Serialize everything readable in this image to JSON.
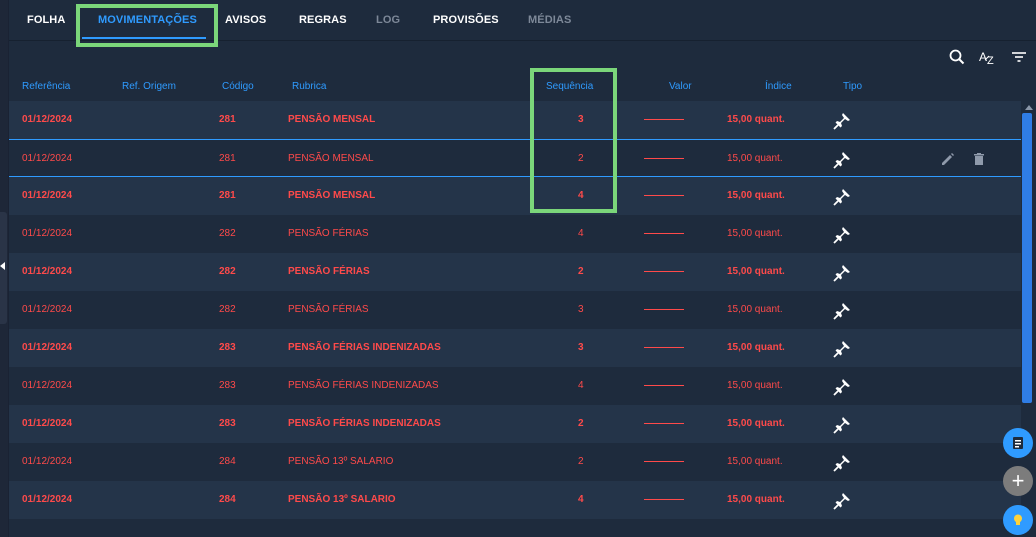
{
  "tabs": [
    {
      "label": "FOLHA",
      "state": "normal"
    },
    {
      "label": "MOVIMENTAÇÕES",
      "state": "active"
    },
    {
      "label": "AVISOS",
      "state": "normal"
    },
    {
      "label": "REGRAS",
      "state": "normal"
    },
    {
      "label": "LOG",
      "state": "disabled"
    },
    {
      "label": "PROVISÕES",
      "state": "normal"
    },
    {
      "label": "MÉDIAS",
      "state": "disabled"
    }
  ],
  "toolbar": {
    "icons": [
      "search-icon",
      "sort-az-icon",
      "filter-icon"
    ]
  },
  "table": {
    "columns": [
      "Referência",
      "Ref. Origem",
      "Código",
      "Rubrica",
      "Sequência",
      "Valor",
      "Índice",
      "Tipo"
    ],
    "rows": [
      {
        "referencia": "01/12/2024",
        "codigo": "281",
        "rubrica": "PENSÃO MENSAL",
        "sequencia": "3",
        "indice": "15,00 quant.",
        "bold": true
      },
      {
        "referencia": "01/12/2024",
        "codigo": "281",
        "rubrica": "PENSÃO MENSAL",
        "sequencia": "2",
        "indice": "15,00 quant.",
        "bold": false
      },
      {
        "referencia": "01/12/2024",
        "codigo": "281",
        "rubrica": "PENSÃO MENSAL",
        "sequencia": "4",
        "indice": "15,00 quant.",
        "bold": true
      },
      {
        "referencia": "01/12/2024",
        "codigo": "282",
        "rubrica": "PENSÃO FÉRIAS",
        "sequencia": "4",
        "indice": "15,00 quant.",
        "bold": false
      },
      {
        "referencia": "01/12/2024",
        "codigo": "282",
        "rubrica": "PENSÃO FÉRIAS",
        "sequencia": "2",
        "indice": "15,00 quant.",
        "bold": true
      },
      {
        "referencia": "01/12/2024",
        "codigo": "282",
        "rubrica": "PENSÃO FÉRIAS",
        "sequencia": "3",
        "indice": "15,00 quant.",
        "bold": false
      },
      {
        "referencia": "01/12/2024",
        "codigo": "283",
        "rubrica": "PENSÃO FÉRIAS INDENIZADAS",
        "sequencia": "3",
        "indice": "15,00 quant.",
        "bold": true
      },
      {
        "referencia": "01/12/2024",
        "codigo": "283",
        "rubrica": "PENSÃO FÉRIAS INDENIZADAS",
        "sequencia": "4",
        "indice": "15,00 quant.",
        "bold": false
      },
      {
        "referencia": "01/12/2024",
        "codigo": "283",
        "rubrica": "PENSÃO FÉRIAS INDENIZADAS",
        "sequencia": "2",
        "indice": "15,00 quant.",
        "bold": true
      },
      {
        "referencia": "01/12/2024",
        "codigo": "284",
        "rubrica": "PENSÃO 13º SALARIO",
        "sequencia": "2",
        "indice": "15,00 quant.",
        "bold": false
      },
      {
        "referencia": "01/12/2024",
        "codigo": "284",
        "rubrica": "PENSÃO 13º SALARIO",
        "sequencia": "4",
        "indice": "15,00 quant.",
        "bold": true
      }
    ],
    "row_icon": "pin-icon",
    "selected_row_actions": [
      "edit-icon",
      "delete-icon"
    ]
  },
  "fabs": [
    "report-icon",
    "add-icon",
    "lightbulb-icon"
  ],
  "fab_add_label": "+",
  "colors": {
    "background": "#1e2b3d",
    "row_alt": "#243449",
    "accent": "#2f9bff",
    "text_red": "#ff4a4a",
    "highlight": "#7bd67a"
  }
}
